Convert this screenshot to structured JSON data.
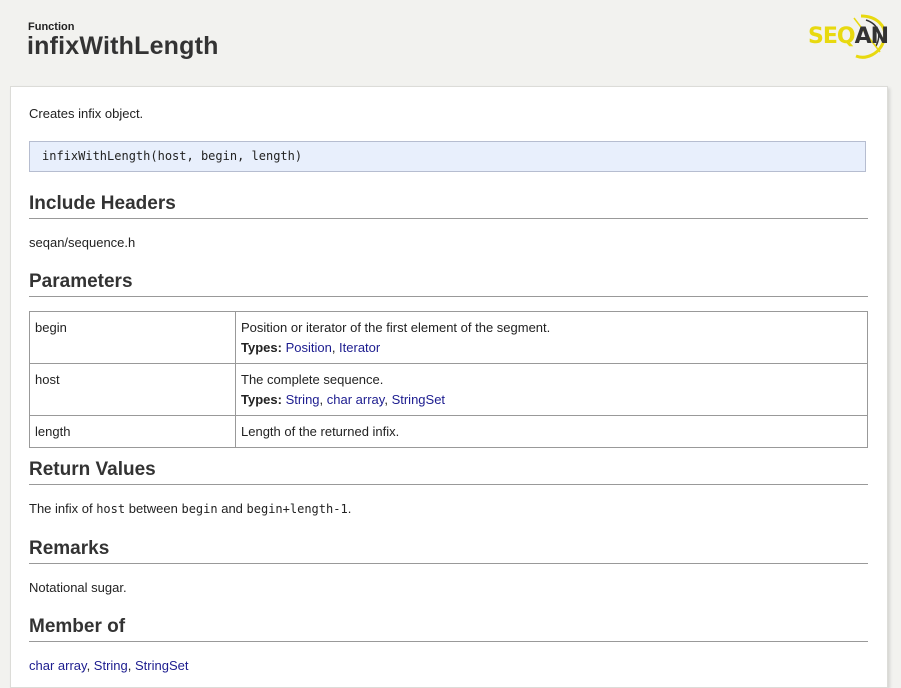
{
  "header": {
    "kind": "Function",
    "title": "infixWithLength",
    "logo_text_a": "SEQ",
    "logo_text_b": "AN"
  },
  "summary": "Creates infix object.",
  "signature": "infixWithLength(host, begin, length)",
  "sections": {
    "include_headers": {
      "heading": "Include Headers",
      "value": "seqan/sequence.h"
    },
    "parameters": {
      "heading": "Parameters",
      "types_label": "Types:",
      "rows": [
        {
          "name": "begin",
          "description": "Position or iterator of the first element of the segment.",
          "types": [
            "Position",
            "Iterator"
          ]
        },
        {
          "name": "host",
          "description": "The complete sequence.",
          "types": [
            "String",
            "char array",
            "StringSet"
          ]
        },
        {
          "name": "length",
          "description": "Length of the returned infix.",
          "types": []
        }
      ]
    },
    "return_values": {
      "heading": "Return Values",
      "text_1": "The infix of ",
      "code_1": "host",
      "text_2": " between ",
      "code_2": "begin",
      "text_3": " and ",
      "code_3": "begin+length-1",
      "text_4": "."
    },
    "remarks": {
      "heading": "Remarks",
      "value": "Notational sugar."
    },
    "member_of": {
      "heading": "Member of",
      "links": [
        "char array",
        "String",
        "StringSet"
      ]
    }
  },
  "colors": {
    "link": "#1c1c8f",
    "signature_bg": "#e8effc",
    "logo_yellow": "#e8d90f"
  }
}
